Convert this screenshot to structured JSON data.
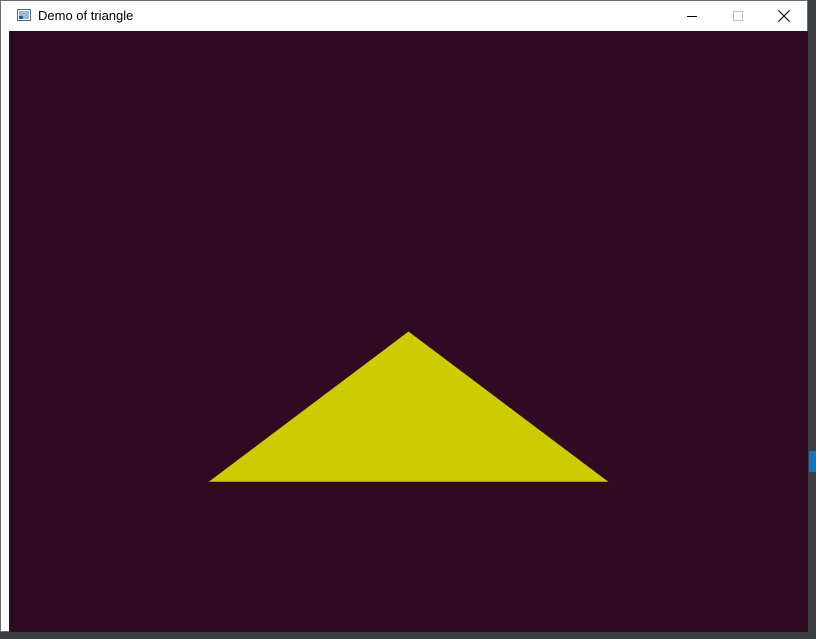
{
  "window": {
    "title": "Demo of triangle",
    "controls": {
      "minimize": "minimize-icon",
      "maximize": "maximize-icon",
      "close": "close-icon"
    }
  },
  "scene": {
    "background_color": "#2e0b22",
    "triangle": {
      "color": "#cccc00",
      "vertices_ndc": [
        [
          -0.5,
          -0.5
        ],
        [
          0.5,
          -0.5
        ],
        [
          0.0,
          0.0
        ]
      ]
    }
  },
  "colors": {
    "titlebar": "#ffffff",
    "backdrop_accent": "#0e74c6"
  }
}
